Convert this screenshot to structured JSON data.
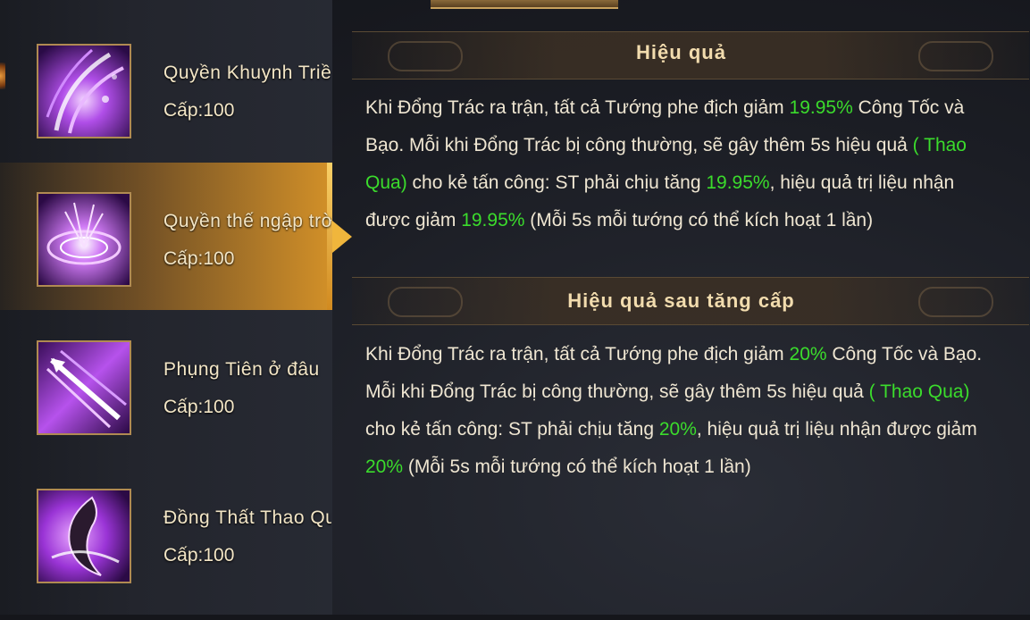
{
  "skills": [
    {
      "name": "Quyền Khuynh Triều Dã",
      "level": "Cấp:100",
      "icon": "purple-slash-skill-icon",
      "selected": false
    },
    {
      "name": "Quyền thế ngập trời",
      "level": "Cấp:100",
      "icon": "purple-vortex-skill-icon",
      "selected": true
    },
    {
      "name": "Phụng Tiên ở đâu",
      "level": "Cấp:100",
      "icon": "purple-spear-skill-icon",
      "selected": false
    },
    {
      "name": "Đồng Thất Thao Qua",
      "level": "Cấp:100",
      "icon": "purple-blade-skill-icon",
      "selected": false
    }
  ],
  "effect": {
    "title": "Hiệu quả",
    "p1": "Khi Đổng Trác ra trận, tất cả Tướng phe địch giảm ",
    "v1": "19.95%",
    "p2": " Công Tốc và Bạo. Mỗi khi Đổng Trác bị công thường, sẽ gây thêm 5s hiệu quả ",
    "v2": "( Thao Qua)",
    "p3": " cho kẻ tấn công: ST phải chịu tăng ",
    "v3": "19.95%",
    "p4": ", hiệu quả trị liệu nhận được giảm ",
    "v4": "19.95%",
    "p5": " (Mỗi 5s mỗi tướng có thể kích hoạt 1 lần)"
  },
  "upgrade": {
    "title": "Hiệu quả sau tăng cấp",
    "p1": "Khi Đổng Trác ra trận, tất cả Tướng phe địch giảm ",
    "v1": "20%",
    "p2": " Công Tốc và Bạo. Mỗi khi Đổng Trác bị công thường, sẽ gây thêm 5s hiệu quả ",
    "v2": "( Thao Qua)",
    "p3": " cho kẻ tấn công: ST phải chịu tăng ",
    "v3": "20%",
    "p4": ", hiệu quả trị liệu nhận được giảm ",
    "v4": "20%",
    "p5": " (Mỗi 5s mỗi tướng có thể kích hoạt 1 lần)"
  },
  "colors": {
    "highlight": "#3bdc2c",
    "selected": "#f0b63c",
    "text": "#efe6d2"
  }
}
